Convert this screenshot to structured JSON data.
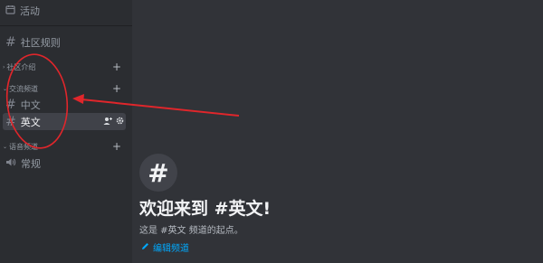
{
  "sidebar": {
    "events": {
      "icon": "calendar-icon",
      "label": "活动"
    },
    "rules": {
      "label": "社区规则"
    },
    "categories": [
      {
        "label": "社区介绍"
      },
      {
        "label": "交流频道"
      },
      {
        "label": "语音频道"
      }
    ],
    "channels": [
      {
        "label": "中文"
      },
      {
        "label": "英文",
        "selected": true
      }
    ],
    "voice": [
      {
        "label": "常规",
        "icon": "speaker-icon"
      }
    ],
    "plus_label": "+",
    "hash": "#"
  },
  "main": {
    "icon_glyph": "#",
    "title": "欢迎来到 #英文!",
    "description": "这是 #英文 频道的起点。",
    "edit_label": "编辑频道"
  },
  "annotation": {
    "color": "#e0262b"
  }
}
